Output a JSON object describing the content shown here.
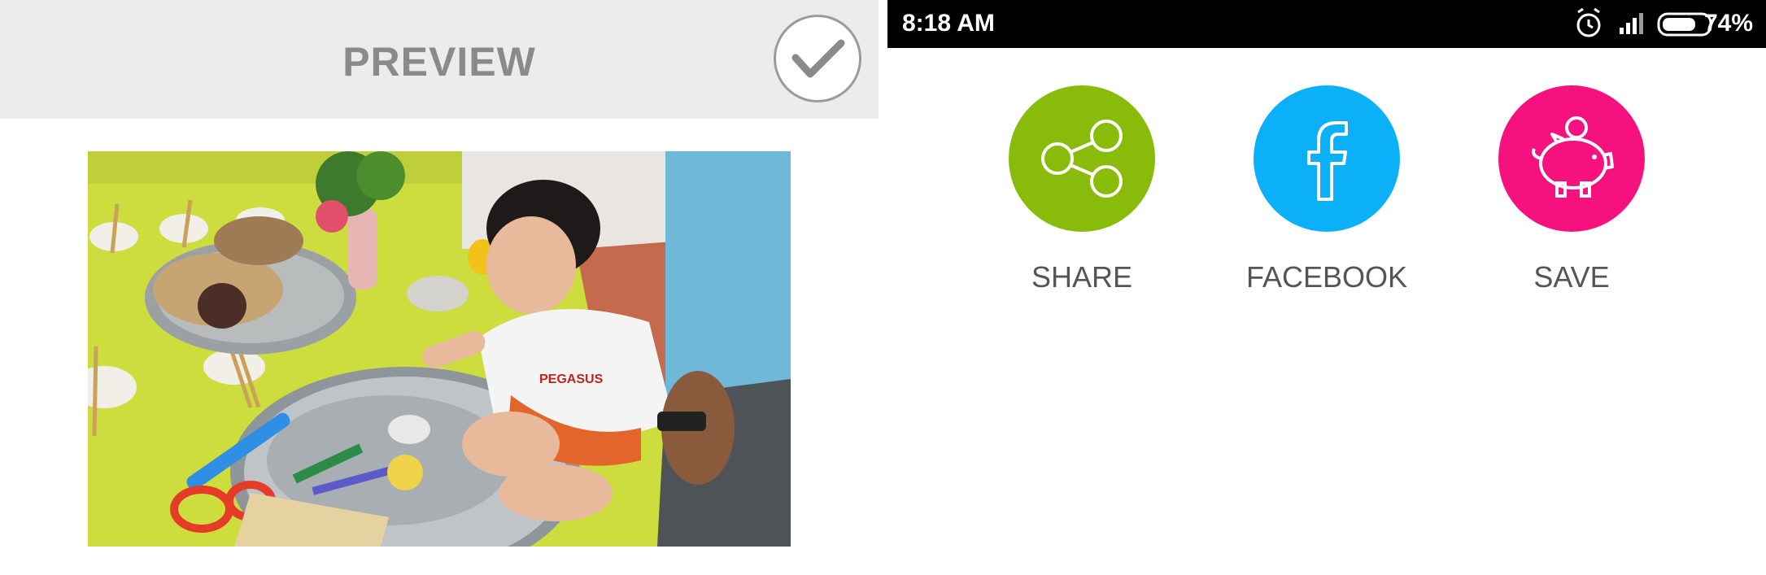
{
  "preview": {
    "title": "PREVIEW",
    "confirm_icon": "checkmark-icon",
    "photo_text": "PEGASUS"
  },
  "status_bar": {
    "time": "8:18 AM",
    "battery_percent": "74%",
    "battery_level": 0.74,
    "icons": [
      "alarm-icon",
      "signal-icon",
      "battery-icon"
    ]
  },
  "share_options": [
    {
      "label": "SHARE",
      "icon": "share-icon",
      "color": "#88bb0a"
    },
    {
      "label": "FACEBOOK",
      "icon": "facebook-icon",
      "color": "#0bb0f8"
    },
    {
      "label": "SAVE",
      "icon": "piggy-bank-icon",
      "color": "#f5127f"
    }
  ]
}
